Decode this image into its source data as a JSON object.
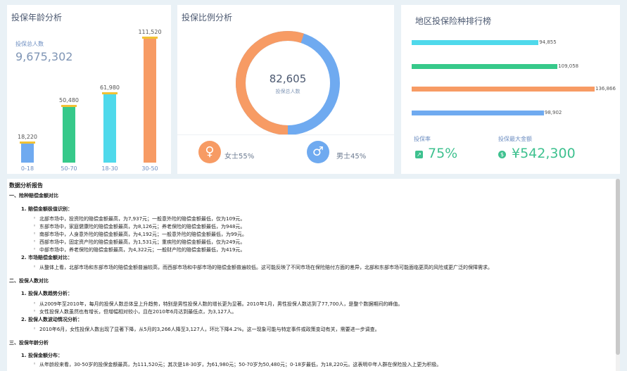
{
  "age_card": {
    "title": "投保年龄分析",
    "total_label": "投保总人数",
    "total_value": "9,675,302"
  },
  "ratio_card": {
    "title": "投保比例分析",
    "center_value": "82,605",
    "center_label": "投保总人数",
    "female_label": "女士55%",
    "male_label": "男士45%",
    "female_color": "#f79b64",
    "male_color": "#6faaf0",
    "female_icon": "female-icon",
    "male_icon": "male-icon"
  },
  "rank_card": {
    "title": "地区投保险种排行榜",
    "bars": [
      {
        "value": 94855,
        "label": "94,855",
        "color": "#4fd9eb"
      },
      {
        "value": 109058,
        "label": "109,058",
        "color": "#36c98a"
      },
      {
        "value": 136866,
        "label": "136,866",
        "color": "#f79b64"
      },
      {
        "value": 98902,
        "label": "98,902",
        "color": "#6faaf0"
      }
    ],
    "rate_label": "投保率",
    "rate_value": "75%",
    "max_label": "投保最大金额",
    "max_value": "¥542,300"
  },
  "chart_data": {
    "type": "bar",
    "categories": [
      "0-18",
      "50-70",
      "18-30",
      "30-50"
    ],
    "values": [
      18220,
      50480,
      61980,
      111520
    ],
    "value_labels": [
      "18,220",
      "50,480",
      "61,980",
      "111,520"
    ],
    "colors": [
      "#6faaf0",
      "#36c98a",
      "#4fd9eb",
      "#f79b64"
    ],
    "ylim": [
      0,
      111520
    ]
  },
  "report": {
    "title": "数据分析报告",
    "s1": "一、险种赔偿金额对比",
    "s1_1": "1. 赔偿金额极值识别：",
    "s1_1_items": [
      "北部市场中，投资险的赔偿金额最高，为7,937元；一般意外险的赔偿金额最低，仅为109元。",
      "东部市场中，家庭健康险的赔偿金额最高，为8,126元；养老保险的赔偿金额最低，为948元。",
      "南部市场中，人身意外险的赔偿金额最高，为4,192元；一般意外险的赔偿金额最低，为99元。",
      "西部市场中，固定资产险的赔偿金额最高，为1,531元；重疾险的赔偿金额最低，仅为249元。",
      "中部市场中，养老保险的赔偿金额最高，为4,322元；一般财产险的赔偿金额最低，为419元。"
    ],
    "s1_2": "2. 市场赔偿金额对比：",
    "s1_2_items": [
      "从整体上看，北部市场和东部市场的赔偿金额普遍较高，而西部市场和中部市场的赔偿金额普遍较低。这可能反映了不同市场在保险赔付方面的差异，北部和东部市场可能面临更高的风险或更广泛的保障需求。"
    ],
    "s2": "二、投保人数对比",
    "s2_1": "1. 投保人数趋势分析：",
    "s2_1_items": [
      "从2009年至2010年，每月的投保人数总体呈上升趋势，特别是男性投保人数的增长更为显著。2010年1月，男性投保人数达到了77,700人，是整个数据期间的峰值。",
      "女性投保人数虽然也有增长，但增幅相对较小，且在2010年6月达到最低点，为3,127人。"
    ],
    "s2_2": "2. 投保人数波动情况分析：",
    "s2_2_items": [
      "2010年6月，女性投保人数出现了显著下降，从5月的3,266人降至3,127人，环比下降4.2%。这一现象可能与特定事件或政策变动有关，需要进一步调查。"
    ],
    "s3": "三、投保年龄分析",
    "s3_1": "1. 投保金额分布：",
    "s3_1_items": [
      "从年龄段来看，30-50岁的投保金额最高，为111,520元；其次是18-30岁，为61,980元；50-70岁为50,480元；0-18岁最低，为18,220元。这表明中年人群在保险投入上更为积极。"
    ]
  }
}
